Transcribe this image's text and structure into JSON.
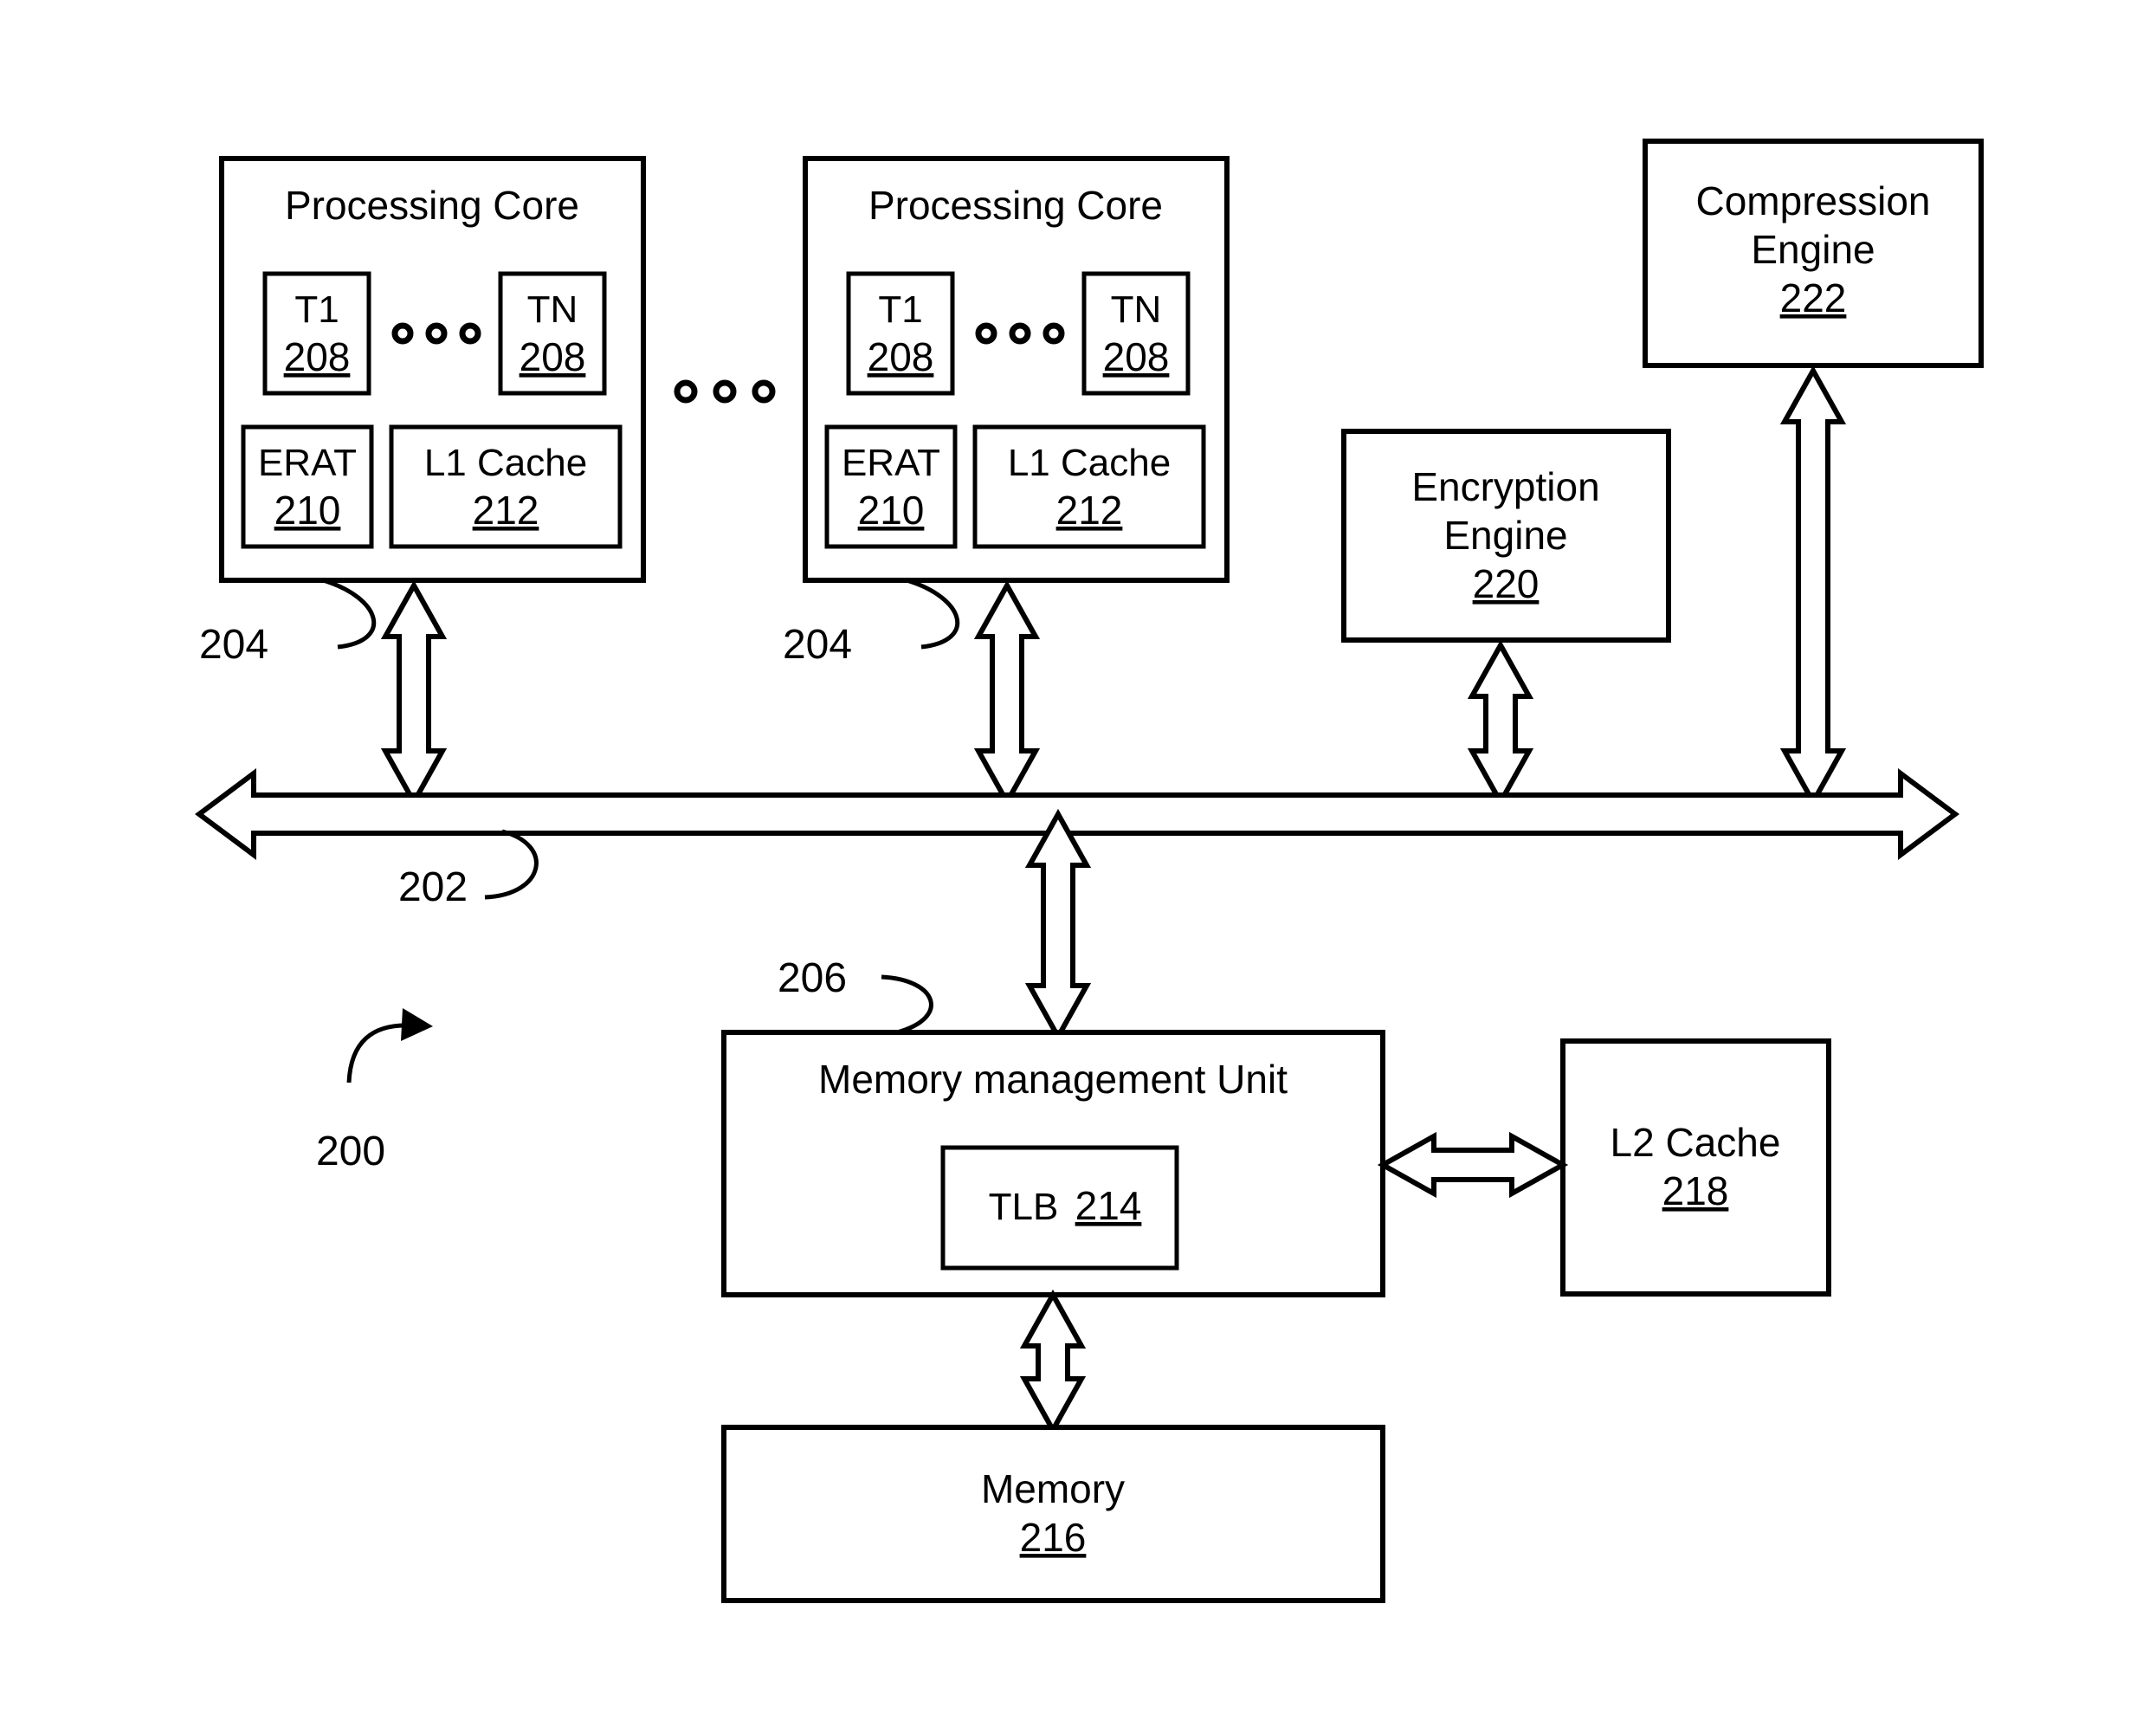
{
  "figure": {
    "id": "200",
    "description": "Processor block diagram",
    "colors": {
      "line": "#000000",
      "fill": "#ffffff"
    }
  },
  "cores": [
    {
      "title": "Processing Core",
      "threads": [
        {
          "label": "T1",
          "ref": "208"
        },
        {
          "label": "TN",
          "ref": "208"
        }
      ],
      "thread_ellipsis": "○ ○ ○",
      "erat": {
        "label": "ERAT",
        "ref": "210"
      },
      "l1": {
        "label": "L1 Cache",
        "ref": "212"
      },
      "bus_link_ref": "204"
    },
    {
      "title": "Processing Core",
      "threads": [
        {
          "label": "T1",
          "ref": "208"
        },
        {
          "label": "TN",
          "ref": "208"
        }
      ],
      "thread_ellipsis": "○ ○ ○",
      "erat": {
        "label": "ERAT",
        "ref": "210"
      },
      "l1": {
        "label": "L1 Cache",
        "ref": "212"
      },
      "bus_link_ref": "204"
    }
  ],
  "core_ellipsis": "○ ○ ○",
  "engines": {
    "compression": {
      "line1": "Compression",
      "line2": "Engine",
      "ref": "222"
    },
    "encryption": {
      "line1": "Encryption",
      "line2": "Engine",
      "ref": "220"
    }
  },
  "bus": {
    "ref": "202"
  },
  "mmu": {
    "title": "Memory management Unit",
    "ref": "206",
    "tlb": {
      "label": "TLB",
      "ref": "214"
    }
  },
  "l2_cache": {
    "label": "L2 Cache",
    "ref": "218"
  },
  "memory": {
    "label": "Memory",
    "ref": "216"
  }
}
